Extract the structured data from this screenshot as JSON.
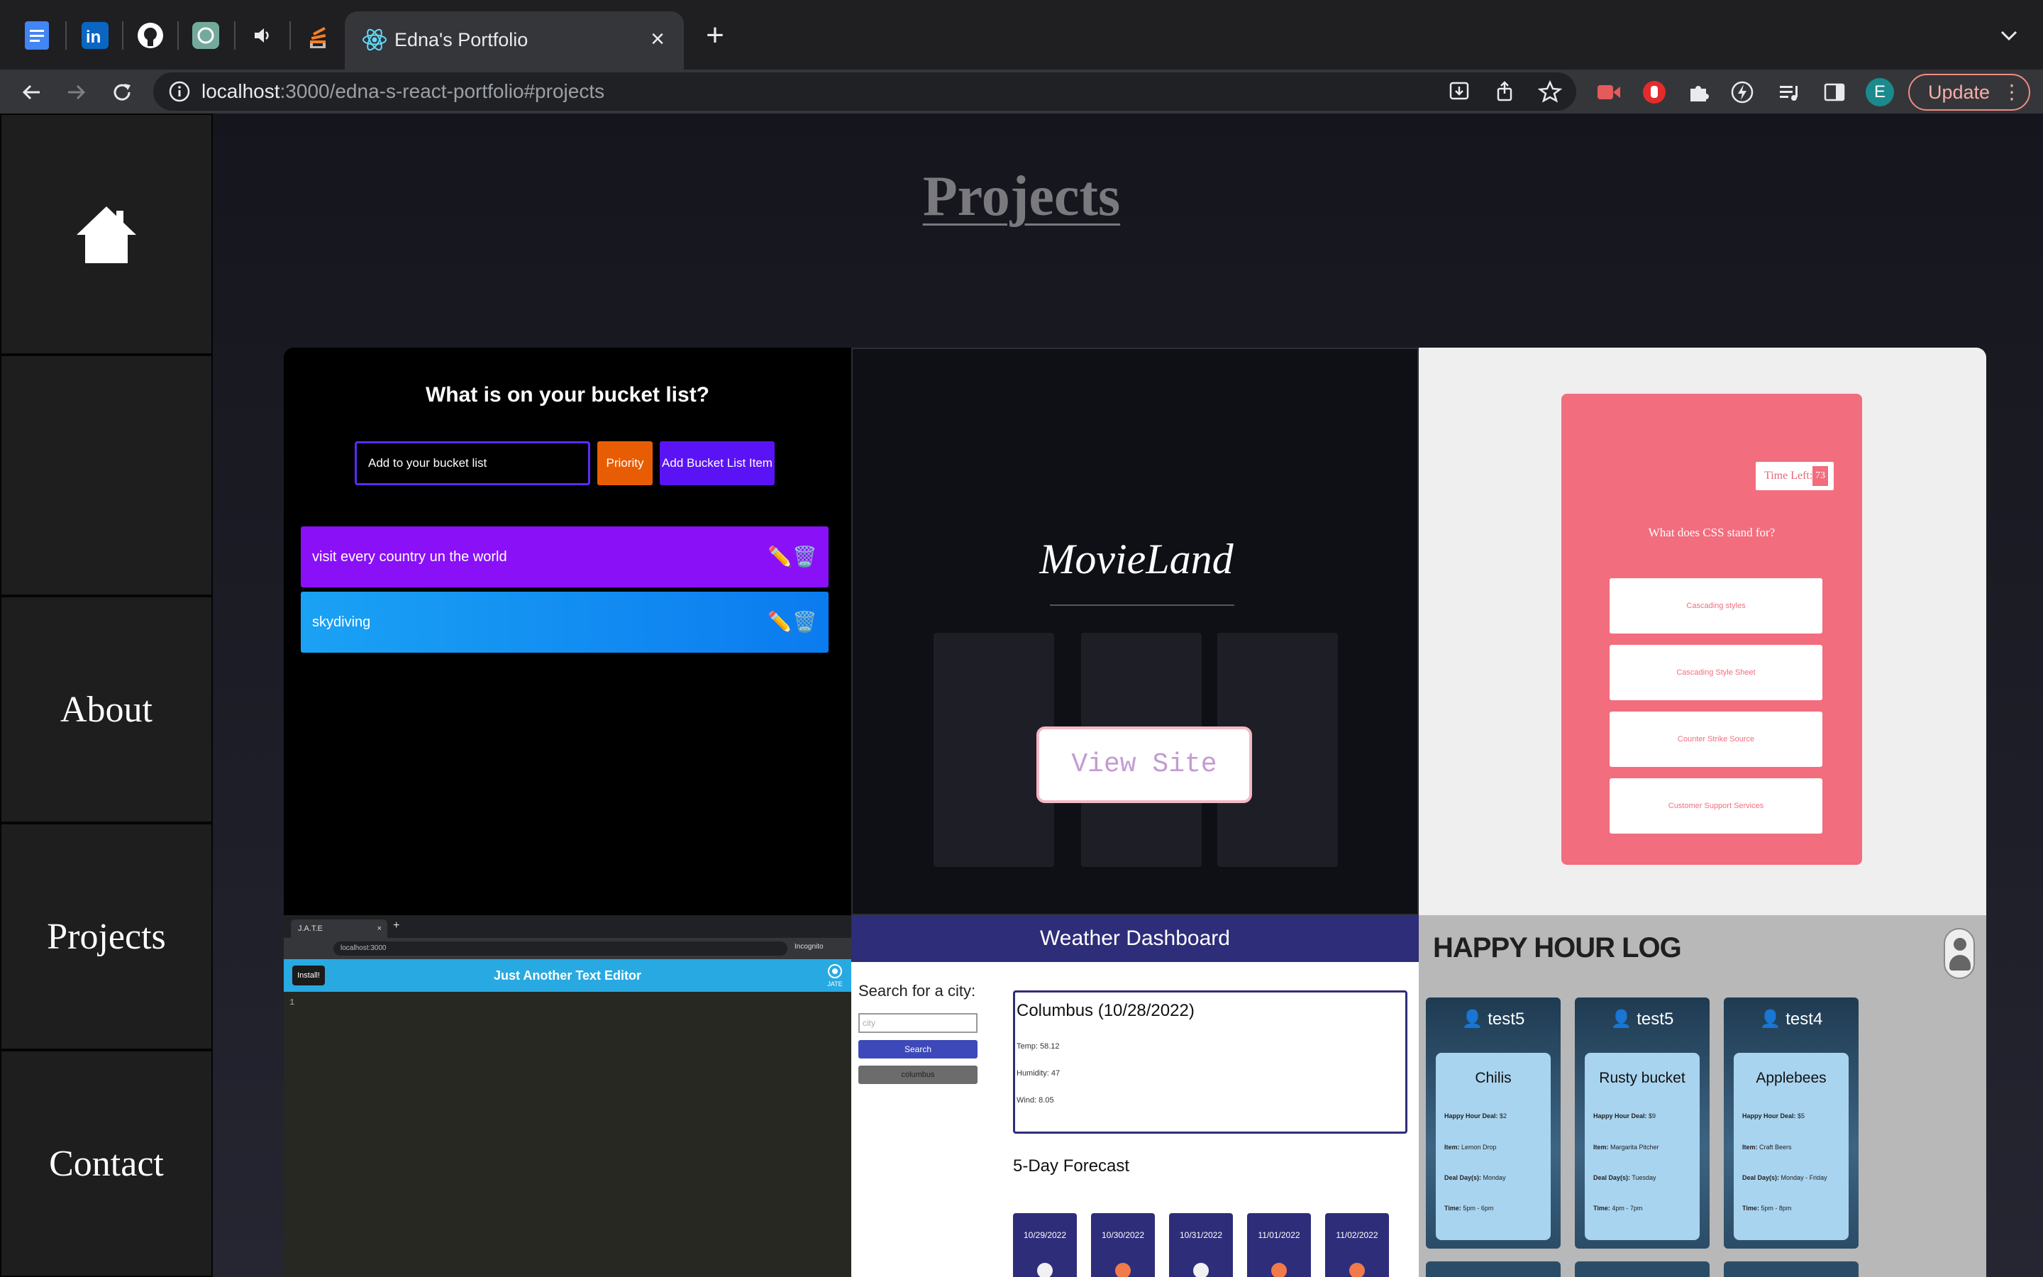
{
  "browser": {
    "tab_title": "Edna's Portfolio",
    "url_host": "localhost",
    "url_rest": ":3000/edna-s-react-portfolio#projects",
    "avatar_initial": "E",
    "update_label": "Update"
  },
  "nav": {
    "about": "About",
    "projects": "Projects",
    "contact": "Contact"
  },
  "page": {
    "title": "Projects"
  },
  "bucket": {
    "question": "What is on your bucket list?",
    "input_placeholder": "Add to your bucket list",
    "priority_label": "Priority",
    "add_label": "Add Bucket List Item",
    "items": [
      {
        "text": "visit every country un the world",
        "color": "#8a10f7"
      },
      {
        "text": "skydiving",
        "color": "#1394f2"
      }
    ]
  },
  "movie": {
    "brand": "MovieLand",
    "view_site": "View Site"
  },
  "quiz": {
    "timer_label": "Time Left:",
    "timer_value": "73",
    "question": "What does CSS stand for?",
    "answers": [
      "Cascading styles",
      "Cascading Style Sheet",
      "Counter Strike Source",
      "Customer Support Services"
    ]
  },
  "jate": {
    "mini_tab": "J.A.T.E",
    "mini_url": "localhost:3000",
    "incognito": "Incognito",
    "install_label": "Install!",
    "title": "Just Another Text Editor",
    "logo_text": "JATE",
    "line_number": "1"
  },
  "weather": {
    "title": "Weather Dashboard",
    "search_label": "Search for a city:",
    "city_placeholder": "city",
    "search_button": "Search",
    "history_button": "columbus",
    "today": {
      "city_date": "Columbus (10/28/2022)",
      "temp": "Temp: 58.12",
      "humidity": "Humidity: 47",
      "wind": "Wind: 8.05"
    },
    "forecast_title": "5-Day Forecast",
    "forecast_dates": [
      "10/29/2022",
      "10/30/2022",
      "10/31/2022",
      "11/01/2022",
      "11/02/2022"
    ]
  },
  "happy": {
    "title": "HAPPY HOUR LOG",
    "cards": [
      {
        "user": "test5",
        "place": "Chilis",
        "deal": "$2",
        "item": "Lemon Drop",
        "days": "Monday",
        "time": "5pm - 6pm"
      },
      {
        "user": "test5",
        "place": "Rusty bucket",
        "deal": "$9",
        "item": "Margarita Pitcher",
        "days": "Tuesday",
        "time": "4pm - 7pm"
      },
      {
        "user": "test4",
        "place": "Applebees",
        "deal": "$5",
        "item": "Craft Beers",
        "days": "Monday - Friday",
        "time": "5pm - 8pm"
      }
    ],
    "labels": {
      "deal": "Happy Hour Deal:",
      "item": "Item:",
      "days": "Deal Day(s):",
      "time": "Time:"
    }
  }
}
